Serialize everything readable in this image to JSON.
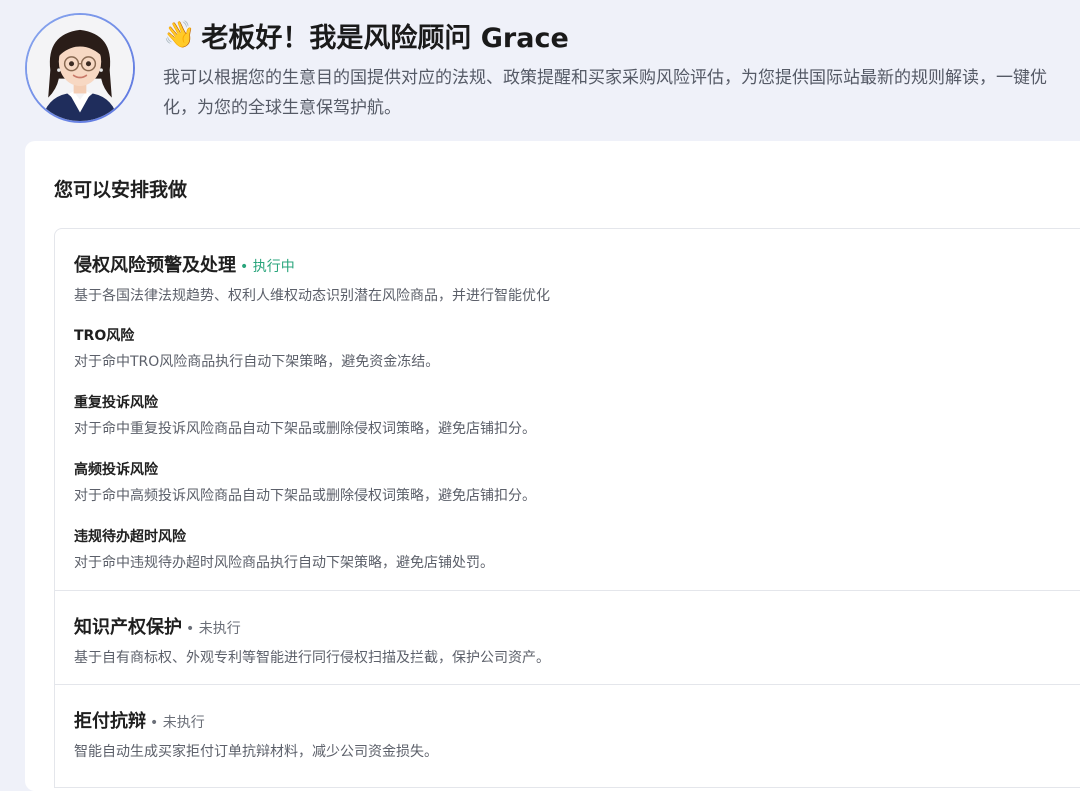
{
  "header": {
    "wave_emoji": "👋",
    "greeting": "老板好！我是风险顾问 Grace",
    "intro": "我可以根据您的生意目的国提供对应的法规、政策提醒和买家采购风险评估，为您提供国际站最新的规则解读，一键优化，为您的全球生意保驾护航。"
  },
  "card": {
    "title": "您可以安排我做"
  },
  "tasks": [
    {
      "title": "侵权风险预警及处理",
      "status": "• 执行中",
      "description": "基于各国法律法规趋势、权利人维权动态识别潜在风险商品，并进行智能优化",
      "subitems": [
        {
          "title": "TRO风险",
          "description": "对于命中TRO风险商品执行自动下架策略，避免资金冻结。"
        },
        {
          "title": "重复投诉风险",
          "description": "对于命中重复投诉风险商品自动下架品或删除侵权词策略，避免店铺扣分。"
        },
        {
          "title": "高频投诉风险",
          "description": "对于命中高频投诉风险商品自动下架品或删除侵权词策略，避免店铺扣分。"
        },
        {
          "title": "违规待办超时风险",
          "description": "对于命中违规待办超时风险商品执行自动下架策略，避免店铺处罚。"
        }
      ]
    },
    {
      "title": "知识产权保护",
      "status": "• 未执行",
      "description": "基于自有商标权、外观专利等智能进行同行侵权扫描及拦截，保护公司资产。"
    },
    {
      "title": "拒付抗辩",
      "status": "• 未执行",
      "description": "智能自动生成买家拒付订单抗辩材料，减少公司资金损失。"
    }
  ],
  "colors": {
    "page_background": "#eff1f9",
    "status_running": "#2aa57c",
    "status_idle": "#6b6f78"
  }
}
